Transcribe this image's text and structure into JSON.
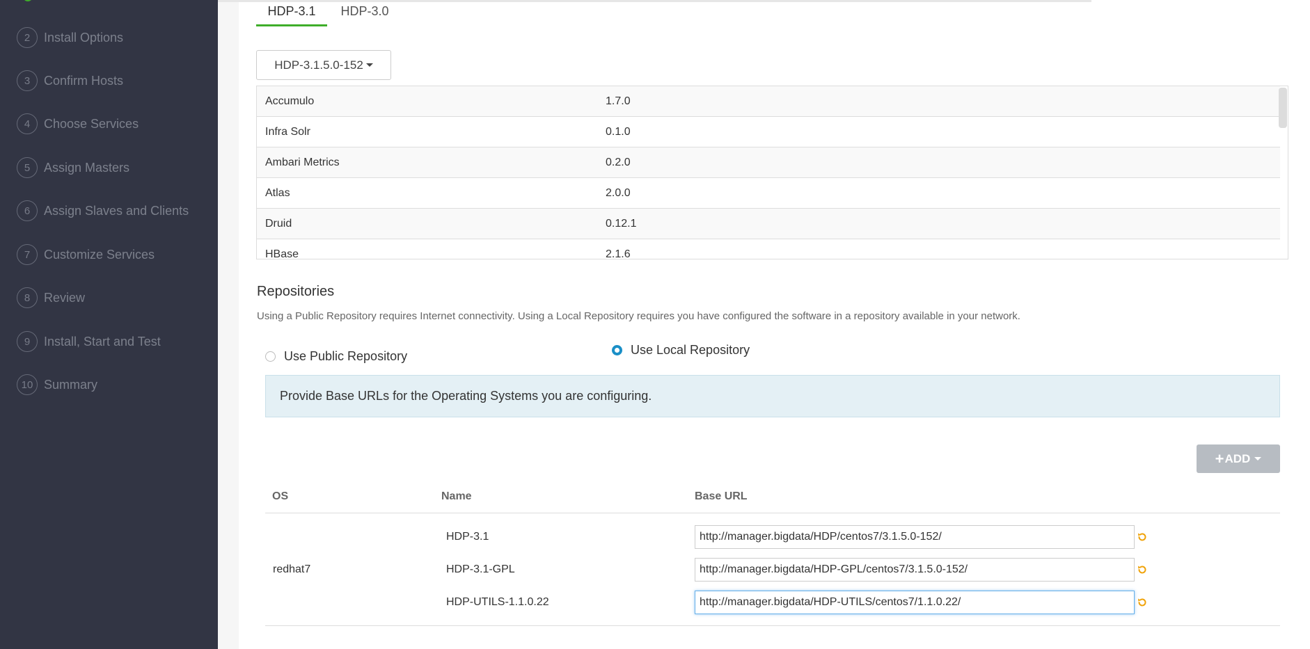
{
  "sidebar": {
    "steps": [
      {
        "num": "2",
        "label": "Install Options"
      },
      {
        "num": "3",
        "label": "Confirm Hosts"
      },
      {
        "num": "4",
        "label": "Choose Services"
      },
      {
        "num": "5",
        "label": "Assign Masters"
      },
      {
        "num": "6",
        "label": "Assign Slaves and Clients"
      },
      {
        "num": "7",
        "label": "Customize Services"
      },
      {
        "num": "8",
        "label": "Review"
      },
      {
        "num": "9",
        "label": "Install, Start and Test"
      },
      {
        "num": "10",
        "label": "Summary"
      }
    ]
  },
  "tabs": [
    {
      "label": "HDP-3.1",
      "active": true
    },
    {
      "label": "HDP-3.0",
      "active": false
    }
  ],
  "version_dropdown": {
    "label": "HDP-3.1.5.0-152"
  },
  "services": [
    {
      "name": "Accumulo",
      "version": "1.7.0"
    },
    {
      "name": "Infra Solr",
      "version": "0.1.0"
    },
    {
      "name": "Ambari Metrics",
      "version": "0.2.0"
    },
    {
      "name": "Atlas",
      "version": "2.0.0"
    },
    {
      "name": "Druid",
      "version": "0.12.1"
    },
    {
      "name": "HBase",
      "version": "2.1.6"
    }
  ],
  "repositories": {
    "title": "Repositories",
    "description": "Using a Public Repository requires Internet connectivity. Using a Local Repository requires you have configured the software in a repository available in your network.",
    "public_option": "Use Public Repository",
    "local_option": "Use Local Repository",
    "selected": "local",
    "info": "Provide Base URLs for the Operating Systems you are configuring.",
    "add_label": "ADD",
    "headers": {
      "os": "OS",
      "name": "Name",
      "base_url": "Base URL"
    },
    "os": "redhat7",
    "rows": [
      {
        "name": "HDP-3.1",
        "url": "http://manager.bigdata/HDP/centos7/3.1.5.0-152/"
      },
      {
        "name": "HDP-3.1-GPL",
        "url": "http://manager.bigdata/HDP-GPL/centos7/3.1.5.0-152/"
      },
      {
        "name": "HDP-UTILS-1.1.0.22",
        "url": "http://manager.bigdata/HDP-UTILS/centos7/1.1.0.22/"
      }
    ]
  },
  "colors": {
    "accent_green": "#3fae2a",
    "radio_blue": "#1a8fc7",
    "undo_orange": "#f0a30a",
    "sidebar_bg": "#323544"
  }
}
